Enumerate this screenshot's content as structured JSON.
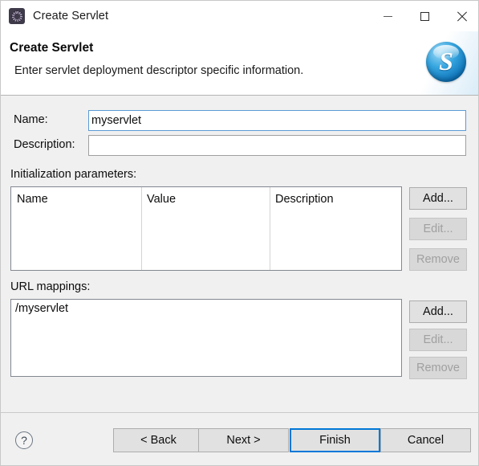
{
  "window": {
    "title": "Create Servlet",
    "icon": "servlet-gear-icon",
    "controls": {
      "minimize": "minimize-icon",
      "maximize": "maximize-icon",
      "close": "close-icon"
    }
  },
  "header": {
    "title": "Create Servlet",
    "description": "Enter servlet deployment descriptor specific information.",
    "logo_letter": "S"
  },
  "form": {
    "name_label": "Name:",
    "name_value": "myservlet",
    "name_placeholder": "",
    "description_label": "Description:",
    "description_value": "",
    "description_placeholder": ""
  },
  "init_params": {
    "section_label": "Initialization parameters:",
    "columns": [
      "Name",
      "Value",
      "Description"
    ],
    "rows": [],
    "buttons": [
      {
        "label": "Add...",
        "enabled": true
      },
      {
        "label": "Edit...",
        "enabled": false
      },
      {
        "label": "Remove",
        "enabled": false
      }
    ]
  },
  "url_mappings": {
    "section_label": "URL mappings:",
    "items": [
      "/myservlet"
    ],
    "buttons": [
      {
        "label": "Add...",
        "enabled": true
      },
      {
        "label": "Edit...",
        "enabled": false
      },
      {
        "label": "Remove",
        "enabled": false
      }
    ]
  },
  "footer": {
    "help": "?",
    "back": "< Back",
    "next": "Next >",
    "finish": "Finish",
    "cancel": "Cancel",
    "default_button": "Finish"
  },
  "colors": {
    "dialog_background": "#f0f0f0",
    "header_background": "#ffffff",
    "focus_border": "#5b9bd5",
    "default_button_border": "#0078d7",
    "logo_blue": "#0a6fb5",
    "disabled_text": "#a0a0a0"
  }
}
